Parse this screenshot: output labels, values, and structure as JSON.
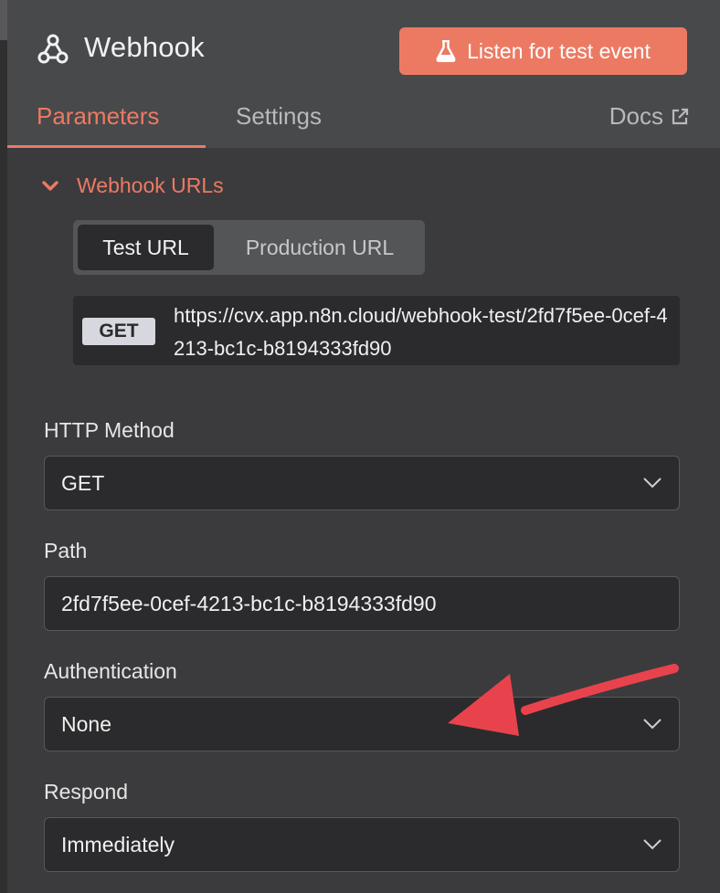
{
  "header": {
    "title": "Webhook",
    "listen_button": "Listen for test event",
    "node_icon": "webhook-icon",
    "listen_icon": "flask-icon"
  },
  "tabs": {
    "parameters": "Parameters",
    "settings": "Settings",
    "docs": "Docs",
    "docs_icon": "external-link-icon",
    "active": "Parameters"
  },
  "webhook_urls": {
    "title": "Webhook URLs",
    "toggle_icon": "chevron-down-icon",
    "options": [
      "Test URL",
      "Production URL"
    ],
    "selected": "Test URL",
    "method": "GET",
    "url": "https://cvx.app.n8n.cloud/webhook-test/2fd7f5ee-0cef-4213-bc1c-b8194333fd90"
  },
  "fields": {
    "http_method": {
      "label": "HTTP Method",
      "value": "GET"
    },
    "path": {
      "label": "Path",
      "value": "2fd7f5ee-0cef-4213-bc1c-b8194333fd90"
    },
    "authentication": {
      "label": "Authentication",
      "value": "None"
    },
    "respond": {
      "label": "Respond",
      "value": "Immediately"
    }
  },
  "colors": {
    "accent": "#ec7a63",
    "annotation_arrow": "#e8434d",
    "panel_bg": "#48494b",
    "content_bg": "#3b3b3d",
    "field_bg": "#2b2b2d"
  }
}
